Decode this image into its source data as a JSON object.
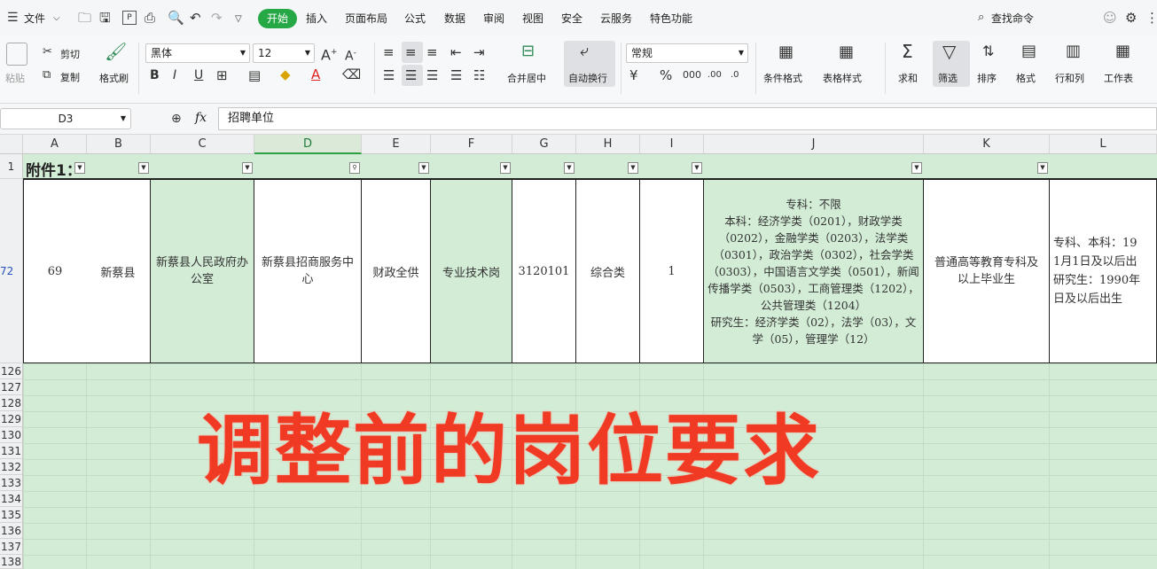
{
  "menubar": {
    "file_label": "文件",
    "start_label": "开始",
    "tabs": [
      "插入",
      "页面布局",
      "公式",
      "数据",
      "审阅",
      "视图",
      "安全",
      "云服务",
      "特色功能"
    ],
    "search_label": "查找命令"
  },
  "ribbon": {
    "paste": "粘贴",
    "cut": "剪切",
    "copy": "复制",
    "format_painter": "格式刷",
    "font_name": "黑体",
    "font_size": "12",
    "merge_center": "合并居中",
    "wrap_text": "自动换行",
    "number_format": "常规",
    "conditional_format": "条件格式",
    "table_style": "表格样式",
    "sum": "求和",
    "filter": "筛选",
    "sort": "排序",
    "format": "格式",
    "rows_cols": "行和列",
    "worksheet": "工作表"
  },
  "formula_bar": {
    "cell_ref": "D3",
    "fx": "fx",
    "content": "招聘单位"
  },
  "sheet": {
    "columns": [
      "A",
      "B",
      "C",
      "D",
      "E",
      "F",
      "G",
      "H",
      "I",
      "J",
      "K",
      "L"
    ],
    "header_row_number": "1",
    "header_text": "附件1：",
    "data_row_number": "72",
    "data_row": {
      "a": "69",
      "b": "新蔡县",
      "c": "新蔡县人民政府办公室",
      "d": "新蔡县招商服务中心",
      "e": "财政全供",
      "f": "专业技术岗",
      "g": "3120101",
      "h": "综合类",
      "i": "1",
      "j": "专科：不限\n本科：经济学类（0201），财政学类（0202），金融学类（0203），法学类（0301），政治学类（0302），社会学类（0303），中国语言文学类（0501），新闻传播学类（0503），工商管理类（1202），公共管理类（1204）\n研究生：经济学类（02），法学（03），文学（05），管理学（12）",
      "k": "普通高等教育专科及以上毕业生",
      "l": "专科、本科：19\n1月1日及以后出\n研究生：1990年\n日及以后出生"
    },
    "empty_rows": [
      "126",
      "127",
      "128",
      "129",
      "130",
      "131",
      "132",
      "133",
      "134",
      "135",
      "136",
      "137",
      "138"
    ]
  },
  "overlay_caption": "调整前的岗位要求",
  "colors": {
    "accent_green": "#27a846",
    "cell_green": "#d3ecd6",
    "caption_red": "#f13a24"
  }
}
